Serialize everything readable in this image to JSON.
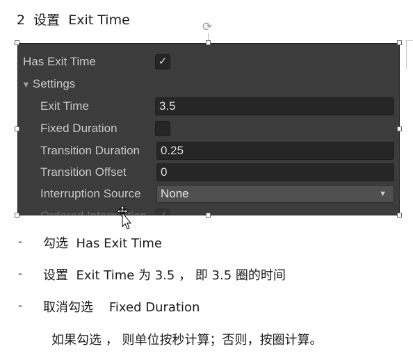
{
  "heading": "2  设置  Exit Time",
  "inspector": {
    "has_exit_time_label": "Has Exit Time",
    "has_exit_time_checked": true,
    "settings_label": "Settings",
    "exit_time_label": "Exit Time",
    "exit_time_value": "3.5",
    "fixed_duration_label": "Fixed Duration",
    "fixed_duration_checked": false,
    "transition_duration_label": "Transition Duration",
    "transition_duration_value": "0.25",
    "transition_offset_label": "Transition Offset",
    "transition_offset_value": "0",
    "interruption_source_label": "Interruption Source",
    "interruption_source_value": "None",
    "ordered_interruption_label": "Ordered Interruption",
    "check_glyph": "✓"
  },
  "notes": {
    "bullet": "-",
    "item1": "勾选  Has Exit Time",
    "item2": "设置  Exit Time 为 3.5 ， 即 3.5 圈的时间",
    "item3": "取消勾选    Fixed Duration",
    "detail": "如果勾选 ， 则单位按秒计算；否则，按圈计算。"
  },
  "colors": {
    "panel_bg": "#3c3c3c",
    "field_bg": "#262626",
    "label_text": "#c8c8c8"
  }
}
